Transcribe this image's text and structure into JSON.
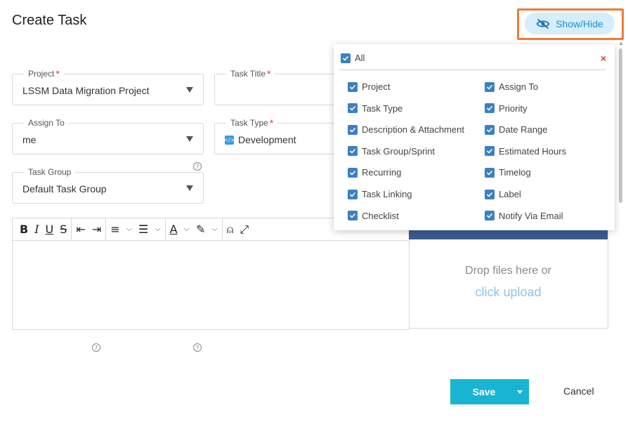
{
  "page": {
    "title": "Create Task"
  },
  "showhide": {
    "label": "Show/Hide"
  },
  "form": {
    "project": {
      "label": "Project",
      "value": "LSSM Data Migration Project"
    },
    "task_title": {
      "label": "Task Title",
      "value": ""
    },
    "assign_to": {
      "label": "Assign To",
      "value": "me"
    },
    "task_type": {
      "label": "Task Type",
      "value": "Development"
    },
    "task_group": {
      "label": "Task Group",
      "value": "Default Task Group"
    },
    "required_mark": "*",
    "help_mark": "?"
  },
  "upload": {
    "drop_text": "Drop files here or",
    "click_text": "click upload"
  },
  "actions": {
    "save_label": "Save",
    "cancel_label": "Cancel"
  },
  "popup": {
    "all_label": "All",
    "close_label": "×",
    "left_options": [
      "Project",
      "Task Type",
      "Description & Attachment",
      "Task Group/Sprint",
      "Recurring",
      "Task Linking",
      "Checklist"
    ],
    "right_options": [
      "Assign To",
      "Priority",
      "Date Range",
      "Estimated Hours",
      "Timelog",
      "Label",
      "Notify Via Email"
    ]
  },
  "colors": {
    "accent": "#17b5d3",
    "highlight_outline": "#ee7a3c",
    "checkbox": "#3b7fc4",
    "required": "#e53935"
  }
}
